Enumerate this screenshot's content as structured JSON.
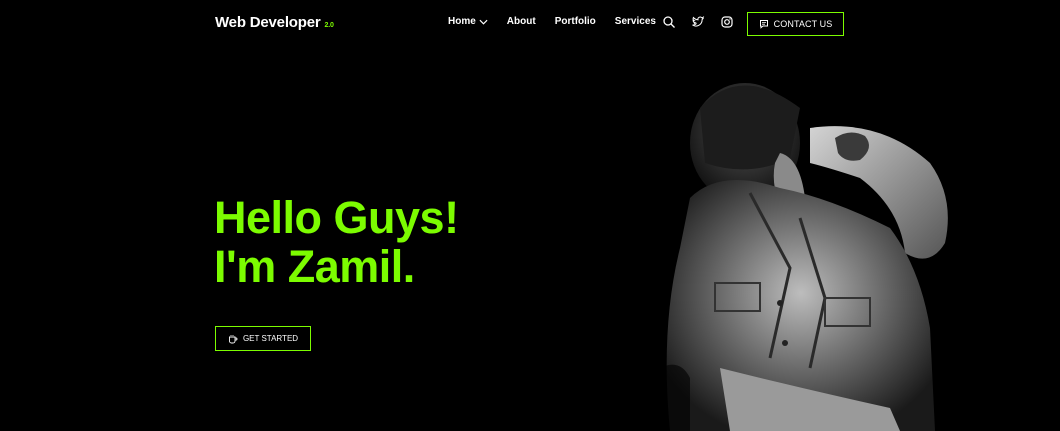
{
  "header": {
    "logo_text": "Web Developer",
    "logo_version": "2.0",
    "nav": [
      {
        "label": "Home",
        "has_dropdown": true
      },
      {
        "label": "About"
      },
      {
        "label": "Portfolio"
      },
      {
        "label": "Services"
      }
    ],
    "icons": [
      "search-icon",
      "twitter-icon",
      "instagram-icon"
    ],
    "contact_label": "CONTACT US"
  },
  "hero": {
    "line1": "Hello Guys!",
    "line2": "I'm Zamil.",
    "cta_label": "GET STARTED"
  },
  "colors": {
    "accent": "#7CFC00",
    "background": "#000000",
    "text": "#FFFFFF"
  }
}
